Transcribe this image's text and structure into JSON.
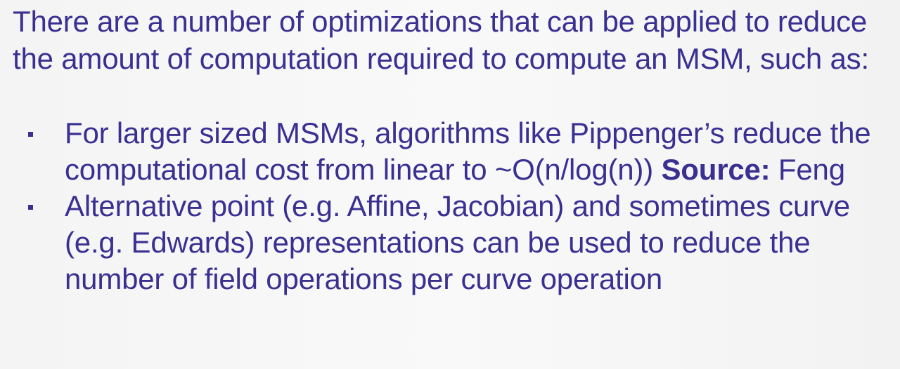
{
  "slide": {
    "intro": "There are a number of optimizations that can be applied to reduce the amount of computation required to compute an MSM, such as:",
    "bullets": [
      {
        "text": "For larger sized MSMs, algorithms like Pippenger’s reduce the computational cost from linear to ~O(n/log(n)) ",
        "source_label": "Source:",
        "source_value": " Feng"
      },
      {
        "text": "Alternative point (e.g. Affine, Jacobian) and sometimes curve (e.g. Edwards) representations can be used to reduce the number of field operations per curve operation"
      }
    ],
    "colors": {
      "text": "#3a3092",
      "background": "#f6f6f6"
    }
  }
}
